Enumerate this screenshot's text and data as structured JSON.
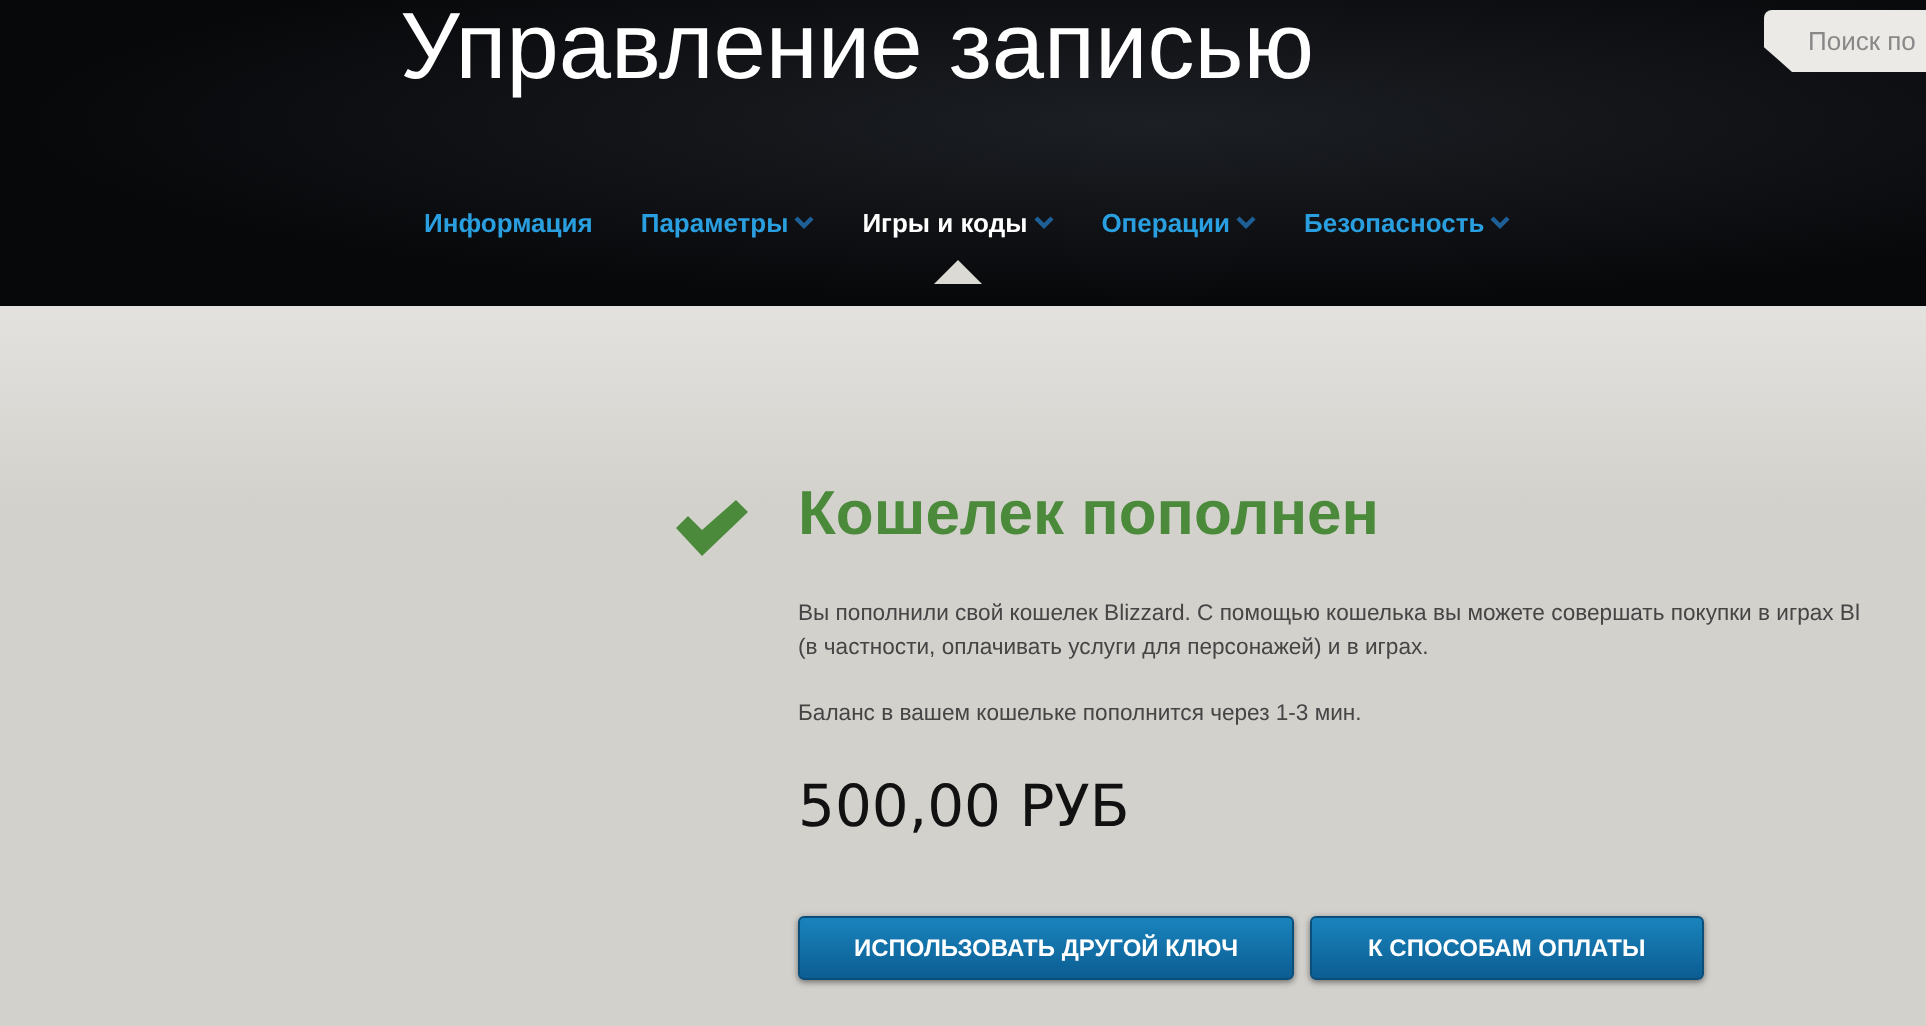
{
  "header": {
    "title": "Управление записью",
    "search": {
      "placeholder": "Поиск по"
    }
  },
  "nav": [
    {
      "label": "Информация",
      "selected": false,
      "dropdown": false
    },
    {
      "label": "Параметры",
      "selected": false,
      "dropdown": true
    },
    {
      "label": "Игры и коды",
      "selected": true,
      "dropdown": true
    },
    {
      "label": "Операции",
      "selected": false,
      "dropdown": true
    },
    {
      "label": "Безопасность",
      "selected": false,
      "dropdown": true
    }
  ],
  "result": {
    "title": "Кошелек пополнен",
    "message_lines": [
      "Вы пополнили свой кошелек Blizzard. С помощью кошелька вы можете совершать покупки в играх Bl",
      "(в частности, оплачивать услуги для персонажей) и в играх."
    ],
    "note": "Баланс в вашем кошельке пополнится через 1-3 мин.",
    "amount": "500,00 РУБ",
    "buttons": [
      "ИСПОЛЬЗОВАТЬ ДРУГОЙ КЛЮЧ",
      "К СПОСОБАМ ОПЛАТЫ"
    ]
  }
}
